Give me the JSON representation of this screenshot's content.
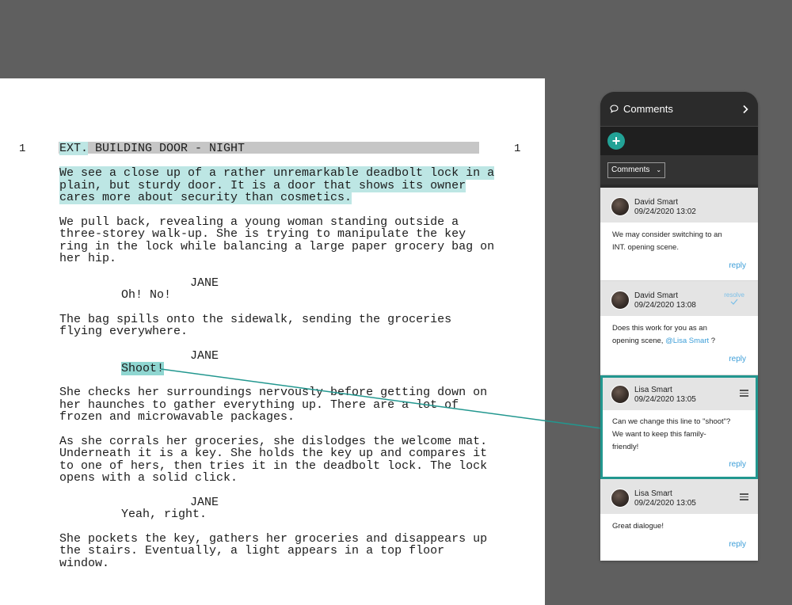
{
  "script": {
    "scene_number_left": "1",
    "scene_number_right": "1",
    "heading": "EXT. BUILDING DOOR - NIGHT",
    "heading_marked": "EXT.",
    "heading_rest": " BUILDING DOOR - NIGHT",
    "action1": [
      "We see a close up of a rather unremarkable deadbolt lock in a",
      "plain, but sturdy door. It is a door that shows its owner",
      "cares more about security than cosmetics."
    ],
    "action2": [
      "We pull back, revealing a young woman standing outside a",
      "three-storey walk-up. She is trying to manipulate the key",
      "ring in the lock while balancing a large paper grocery bag on",
      "her hip."
    ],
    "char1": "JANE",
    "dial1": "Oh! No!",
    "action3": [
      "The bag spills onto the sidewalk, sending the groceries",
      "flying everywhere."
    ],
    "char2": "JANE",
    "dial2": "Shoot!",
    "action4": [
      "She checks her surroundings nervously before getting down on",
      "her haunches to gather everything up. There are a lot of",
      "frozen and microwavable packages."
    ],
    "action5": [
      "As she corrals her groceries, she dislodges the welcome mat.",
      "Underneath it is a key. She holds the key up and compares it",
      "to one of hers, then tries it in the deadbolt lock. The lock",
      "opens with a solid click."
    ],
    "char3": "JANE",
    "dial3": "Yeah, right.",
    "action6": [
      "She pockets the key, gathers her groceries and disappears up",
      "the stairs. Eventually, a light appears in a top floor",
      "window."
    ]
  },
  "panel": {
    "title": "Comments",
    "add_symbol": "+",
    "filter_value": "Comments",
    "comments": [
      {
        "name": "David Smart",
        "date": "09/24/2020 13:02",
        "lines": [
          "We may consider switching to an",
          "INT. opening scene."
        ],
        "reply": "reply"
      },
      {
        "name": "David Smart",
        "date": "09/24/2020 13:08",
        "resolve": "resolve",
        "line1": "Does this work for you as an",
        "line2_before": "opening scene, ",
        "mention": "@Lisa Smart",
        "line2_after": " ?",
        "reply": "reply"
      },
      {
        "name": "Lisa Smart",
        "date": "09/24/2020 13:05",
        "lines": [
          "Can we change this line to \"shoot\"?",
          "We want to keep this family-",
          "friendly!"
        ],
        "reply": "reply"
      },
      {
        "name": "Lisa Smart",
        "date": "09/24/2020 13:05",
        "lines": [
          "Great dialogue!"
        ],
        "reply": "reply"
      }
    ]
  },
  "colors": {
    "teal_accent": "#22978f",
    "highlight_teal": "#bde6e4",
    "highlight_gray": "#c6c6c6",
    "link_blue": "#3d9ed8"
  }
}
